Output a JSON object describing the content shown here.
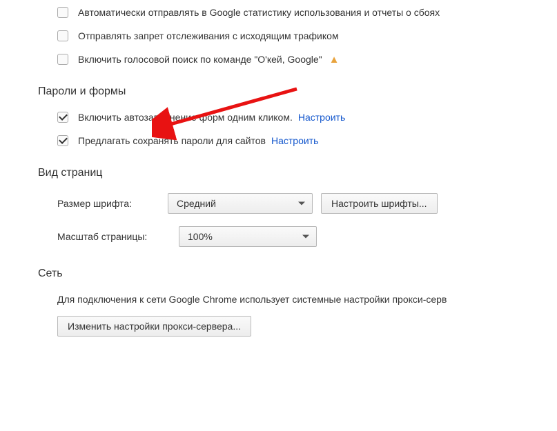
{
  "privacy": {
    "stats_label": "Автоматически отправлять в Google статистику использования и отчеты о сбоях",
    "dnt_label": "Отправлять запрет отслеживания с исходящим трафиком",
    "voice_label": "Включить голосовой поиск по команде \"О'кей, Google\""
  },
  "passwords": {
    "title": "Пароли и формы",
    "autofill_label": "Включить автозаполнение форм одним кликом.",
    "autofill_link": "Настроить",
    "savepw_label": "Предлагать сохранять пароли для сайтов",
    "savepw_link": "Настроить"
  },
  "appearance": {
    "title": "Вид страниц",
    "font_size_label": "Размер шрифта:",
    "font_size_value": "Средний",
    "font_button": "Настроить шрифты...",
    "zoom_label": "Масштаб страницы:",
    "zoom_value": "100%"
  },
  "network": {
    "title": "Сеть",
    "desc": "Для подключения к сети Google Chrome использует системные настройки прокси-серв",
    "button": "Изменить настройки прокси-сервера..."
  }
}
